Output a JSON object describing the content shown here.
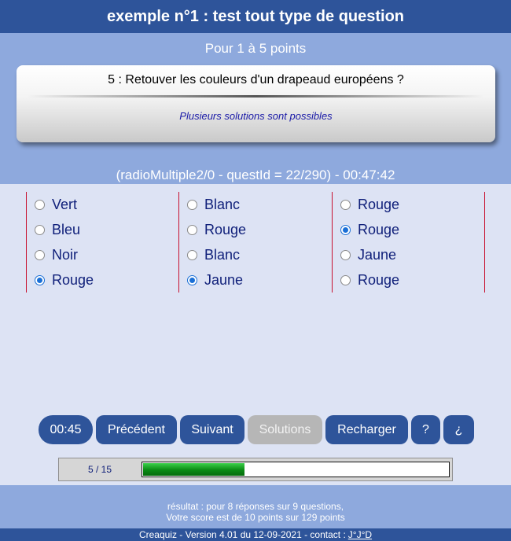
{
  "header": {
    "title": "exemple n°1 : test tout type de question"
  },
  "points_label": "Pour 1 à 5 points",
  "question": {
    "text": "5 : Retouver les couleurs d'un drapeaud européens ?",
    "hint": "Plusieurs solutions sont possibles"
  },
  "question_info": "(radioMultiple2/0 - questId = 22/290) - 00:47:42",
  "columns": [
    {
      "options": [
        {
          "label": "Vert",
          "selected": false
        },
        {
          "label": "Bleu",
          "selected": false
        },
        {
          "label": "Noir",
          "selected": false
        },
        {
          "label": "Rouge",
          "selected": true
        }
      ]
    },
    {
      "options": [
        {
          "label": "Blanc",
          "selected": false
        },
        {
          "label": "Rouge",
          "selected": false
        },
        {
          "label": "Blanc",
          "selected": false
        },
        {
          "label": "Jaune",
          "selected": true
        }
      ]
    },
    {
      "options": [
        {
          "label": "Rouge",
          "selected": false
        },
        {
          "label": "Rouge",
          "selected": true
        },
        {
          "label": "Jaune",
          "selected": false
        },
        {
          "label": "Rouge",
          "selected": false
        }
      ]
    }
  ],
  "buttons": {
    "timer": "00:45",
    "previous": "Précédent",
    "next": "Suivant",
    "solutions": "Solutions",
    "reload": "Recharger",
    "help": "?",
    "inverse_help": "¿"
  },
  "progress": {
    "label": "5 / 15",
    "fraction": 0.333
  },
  "result": {
    "line1": "résultat : pour 8 réponses sur 9 questions,",
    "line2": "Votre score est de 10 points sur 129 points"
  },
  "footer": {
    "text": "Creaquiz - Version 4.01 du 12-09-2021 - contact :",
    "contact_link": "J°J°D"
  },
  "colors": {
    "header_bg": "#2e549a",
    "band_bg": "#8ea9dd",
    "body_bg": "#dde3f4",
    "option_text": "#10207a",
    "column_border": "#c8102e",
    "progress_fill": "#0a8a14"
  }
}
